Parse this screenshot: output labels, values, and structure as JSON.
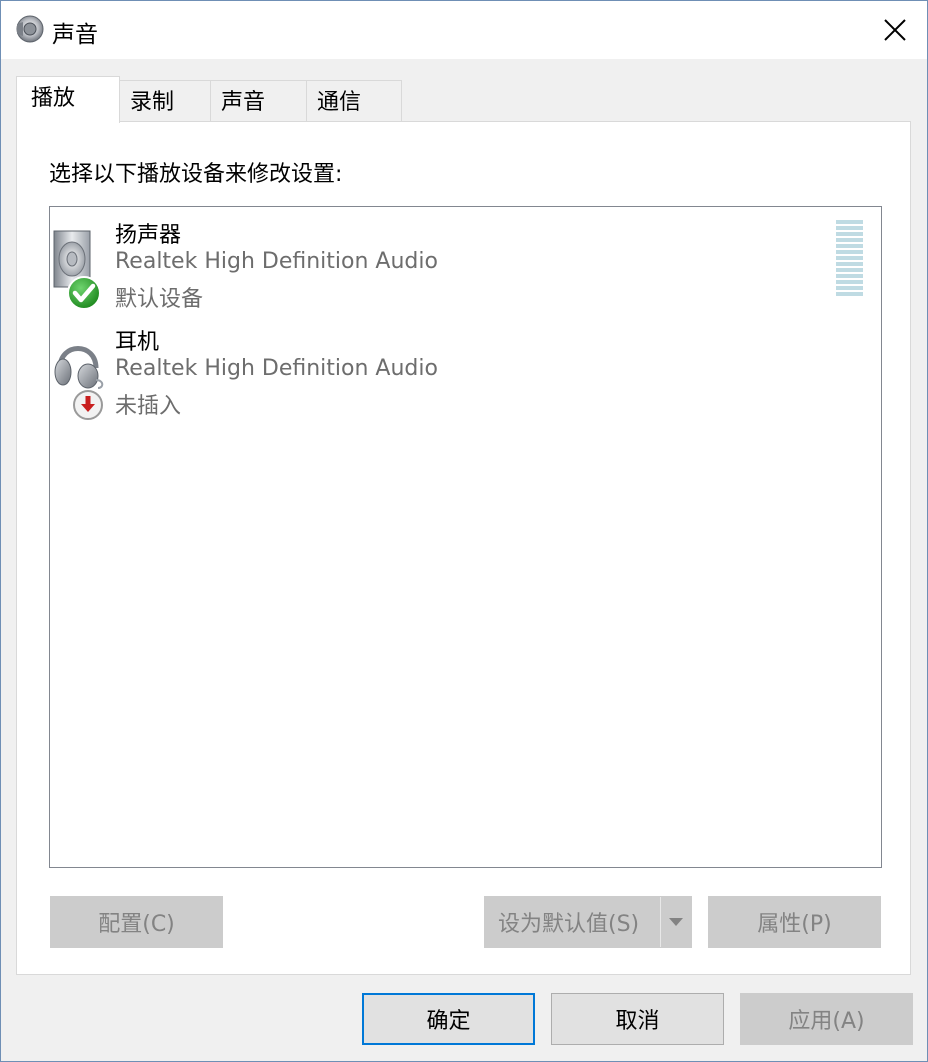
{
  "window": {
    "title": "声音"
  },
  "tabs": [
    {
      "label": "播放"
    },
    {
      "label": "录制"
    },
    {
      "label": "声音"
    },
    {
      "label": "通信"
    }
  ],
  "panel": {
    "instruction": "选择以下播放设备来修改设置:",
    "devices": [
      {
        "name": "扬声器",
        "driver": "Realtek High Definition Audio",
        "status": "默认设备",
        "icon": "speaker-icon",
        "badge": "check-badge-icon"
      },
      {
        "name": "耳机",
        "driver": "Realtek High Definition Audio",
        "status": "未插入",
        "icon": "headphones-icon",
        "badge": "unplugged-badge-icon"
      }
    ],
    "buttons": {
      "configure": "配置(C)",
      "set_default": "设为默认值(S)",
      "properties": "属性(P)"
    }
  },
  "footer": {
    "ok": "确定",
    "cancel": "取消",
    "apply": "应用(A)"
  },
  "colors": {
    "accent": "#0078d7",
    "check_green": "#2e9e2e",
    "unplugged_red": "#c81e1e",
    "level_meter": "#bfdbe3"
  }
}
